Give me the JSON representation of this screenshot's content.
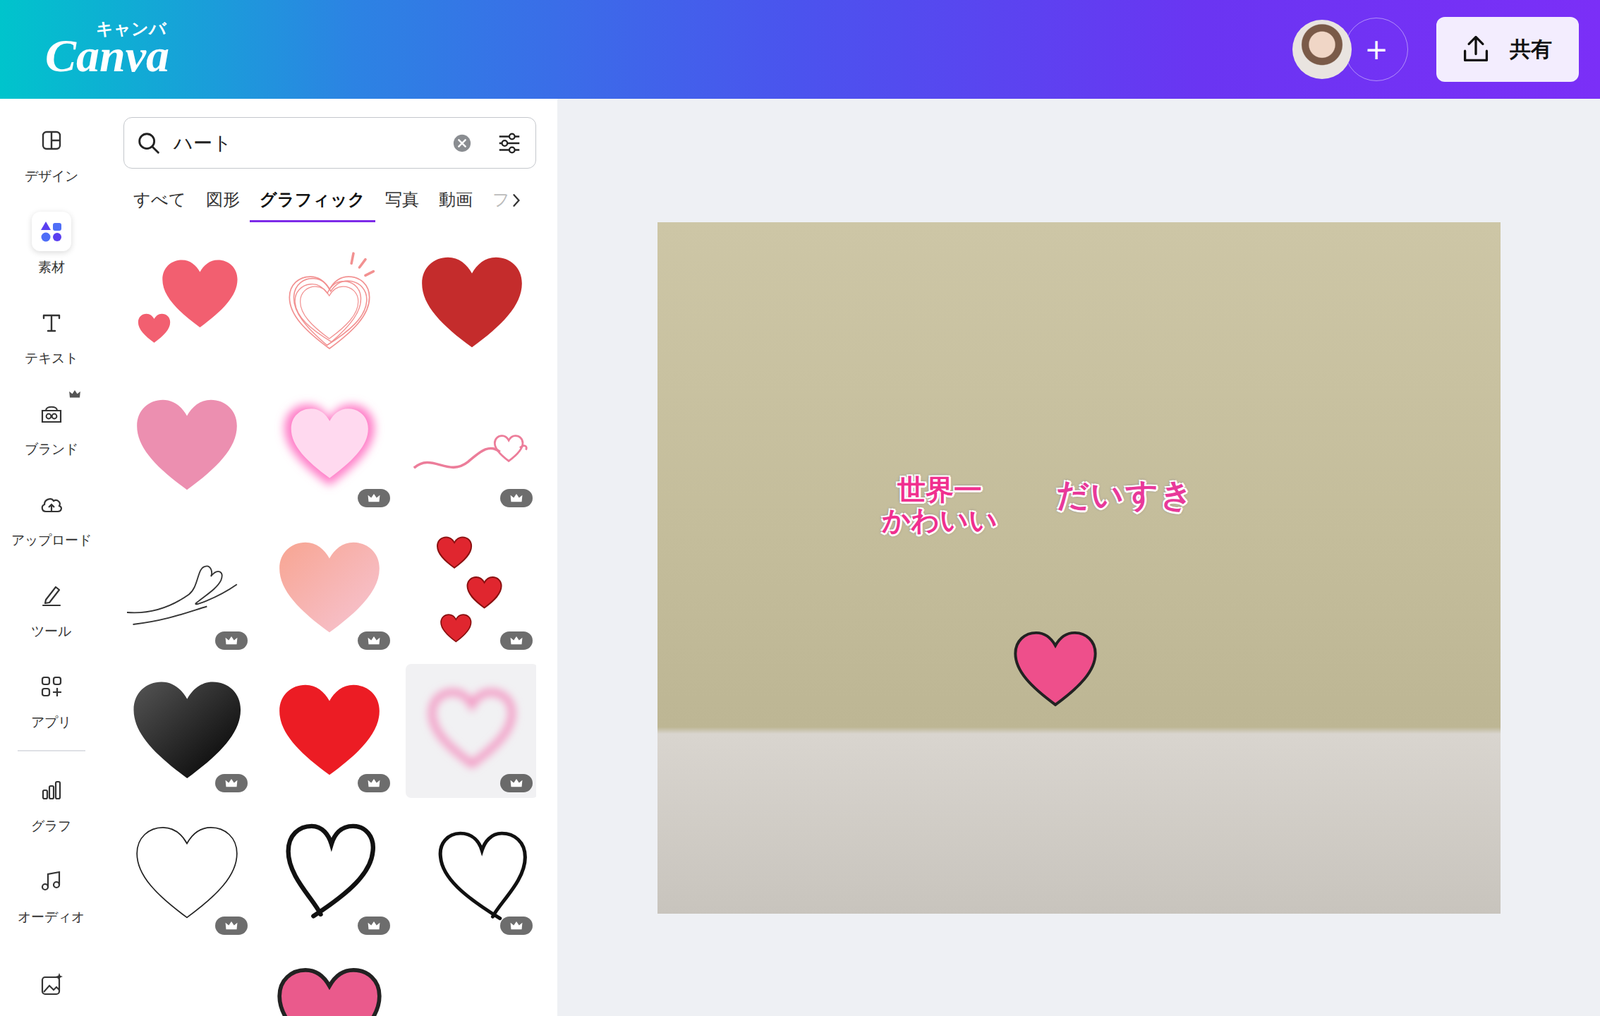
{
  "header": {
    "logo": "Canva",
    "logo_sub": "キャンバ",
    "add_button": "+",
    "share_button": "共有"
  },
  "rail": {
    "items": [
      {
        "label": "デザイン",
        "selected": false,
        "premium": false
      },
      {
        "label": "素材",
        "selected": true,
        "premium": false
      },
      {
        "label": "テキスト",
        "selected": false,
        "premium": false
      },
      {
        "label": "ブランド",
        "selected": false,
        "premium": true
      },
      {
        "label": "アップロード",
        "selected": false,
        "premium": false
      },
      {
        "label": "ツール",
        "selected": false,
        "premium": false
      },
      {
        "label": "アプリ",
        "selected": false,
        "premium": false
      },
      {
        "label": "グラフ",
        "selected": false,
        "premium": false
      },
      {
        "label": "オーディオ",
        "selected": false,
        "premium": false
      }
    ]
  },
  "panel": {
    "search": {
      "value": "ハート"
    },
    "tabs": [
      {
        "label": "すべて",
        "selected": false,
        "cut": false
      },
      {
        "label": "図形",
        "selected": false,
        "cut": false
      },
      {
        "label": "グラフィック",
        "selected": true,
        "cut": false
      },
      {
        "label": "写真",
        "selected": false,
        "cut": false
      },
      {
        "label": "動画",
        "selected": false,
        "cut": false
      },
      {
        "label": "フ",
        "selected": false,
        "cut": true
      }
    ],
    "graphics": [
      {
        "kind": "double",
        "color": "#f25f70",
        "premium": false
      },
      {
        "kind": "scribble",
        "color": "#f29191",
        "premium": false
      },
      {
        "kind": "solid",
        "color": "#c42c2c",
        "premium": false
      },
      {
        "kind": "solid",
        "color": "#ec8fb0",
        "premium": false
      },
      {
        "kind": "glow",
        "color": "#ffd9ef",
        "premium": true
      },
      {
        "kind": "ribbon",
        "color": "#ec7d9a",
        "premium": true
      },
      {
        "kind": "line",
        "color": "#333333",
        "premium": true
      },
      {
        "kind": "watercolor",
        "color": "#f5a29a",
        "premium": true
      },
      {
        "kind": "scatter",
        "color": "#e0262f",
        "premium": true
      },
      {
        "kind": "gradient",
        "color": "#000000",
        "premium": true
      },
      {
        "kind": "solid",
        "color": "#ec1c24",
        "premium": true
      },
      {
        "kind": "blur-ring",
        "color": "#f39ac4",
        "premium": true
      },
      {
        "kind": "outline-thin",
        "color": "#222222",
        "premium": true
      },
      {
        "kind": "outline-bold",
        "color": "#111111",
        "premium": true
      },
      {
        "kind": "outline-open",
        "color": "#111111",
        "premium": true
      },
      {
        "kind": "blank",
        "color": "#ffffff",
        "premium": false
      },
      {
        "kind": "outlined",
        "color": "#ea5a8c",
        "premium": false
      },
      {
        "kind": "blank",
        "color": "#ffffff",
        "premium": false
      }
    ]
  },
  "design": {
    "stickers": [
      {
        "kind": "badge",
        "lines": [
          "世界一",
          "かわいい"
        ]
      },
      {
        "kind": "word",
        "lines": [
          "だいすき"
        ]
      },
      {
        "kind": "heart",
        "lines": []
      }
    ]
  }
}
